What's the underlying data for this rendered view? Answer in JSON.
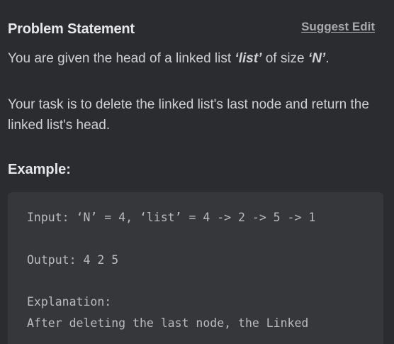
{
  "header": {
    "title": "Problem Statement",
    "suggest_edit": "Suggest Edit"
  },
  "statement": {
    "p1_prefix": "You are given the head of a linked list ",
    "p1_list": "‘list’",
    "p1_middle": " of size ",
    "p1_n": "‘N’",
    "p1_suffix": ".",
    "p2": "Your task is to delete the linked list's last node and return the linked list's head."
  },
  "example": {
    "label": "Example:",
    "lines": {
      "input": "Input: ‘N’ = 4, ‘list’ = 4 -> 2 -> 5 -> 1",
      "output": "Output: 4 2 5",
      "explanation_label": "Explanation:",
      "explanation_text": "After deleting the last node, the Linked"
    }
  }
}
